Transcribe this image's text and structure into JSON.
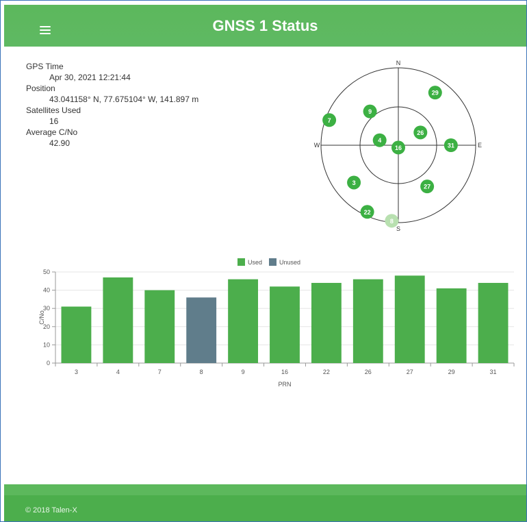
{
  "header": {
    "title": "GNSS 1 Status",
    "menu_icon": "hamburger-menu-icon"
  },
  "status": {
    "gps_time_label": "GPS Time",
    "gps_time": "Apr 30, 2021 12:21:44",
    "position_label": "Position",
    "position": "43.041158° N, 77.675104° W, 141.897 m",
    "satellites_used_label": "Satellites Used",
    "satellites_used": "16",
    "avg_cno_label": "Average C/No",
    "avg_cno": "42.90"
  },
  "skyplot": {
    "directions": {
      "n": "N",
      "e": "E",
      "s": "S",
      "w": "W"
    },
    "satellites": [
      {
        "prn": "29",
        "azimuth": 35,
        "elevation_ratio": 0.83,
        "used": true
      },
      {
        "prn": "9",
        "azimuth": 320,
        "elevation_ratio": 0.57,
        "used": true
      },
      {
        "prn": "7",
        "azimuth": 290,
        "elevation_ratio": 0.95,
        "used": true
      },
      {
        "prn": "26",
        "azimuth": 60,
        "elevation_ratio": 0.33,
        "used": true
      },
      {
        "prn": "4",
        "azimuth": 285,
        "elevation_ratio": 0.25,
        "used": true
      },
      {
        "prn": "16",
        "azimuth": 180,
        "elevation_ratio": 0.03,
        "used": true
      },
      {
        "prn": "31",
        "azimuth": 90,
        "elevation_ratio": 0.68,
        "used": true
      },
      {
        "prn": "3",
        "azimuth": 230,
        "elevation_ratio": 0.75,
        "used": true
      },
      {
        "prn": "27",
        "azimuth": 145,
        "elevation_ratio": 0.65,
        "used": true
      },
      {
        "prn": "22",
        "azimuth": 205,
        "elevation_ratio": 0.95,
        "used": true
      },
      {
        "prn": "8",
        "azimuth": 185,
        "elevation_ratio": 0.98,
        "used": false
      }
    ]
  },
  "chart_data": {
    "type": "bar",
    "xlabel": "PRN",
    "ylabel": "C/No",
    "ylim": [
      0,
      50
    ],
    "yticks": [
      0,
      10,
      20,
      30,
      40,
      50
    ],
    "legend": [
      "Used",
      "Unused"
    ],
    "legend_position": "top-center",
    "categories": [
      "3",
      "4",
      "7",
      "8",
      "9",
      "16",
      "22",
      "26",
      "27",
      "29",
      "31"
    ],
    "values": [
      31,
      47,
      40,
      36,
      46,
      42,
      44,
      46,
      48,
      41,
      44
    ],
    "used": [
      true,
      true,
      true,
      false,
      true,
      true,
      true,
      true,
      true,
      true,
      true
    ],
    "colors": {
      "used": "#4cae4c",
      "unused": "#607d8b"
    }
  },
  "footer": {
    "copyright": "© 2018 Talen-X"
  },
  "colors": {
    "header": "#5cb85c",
    "satellite_used": "#3cb043",
    "satellite_unused": "#b8e0b0"
  }
}
